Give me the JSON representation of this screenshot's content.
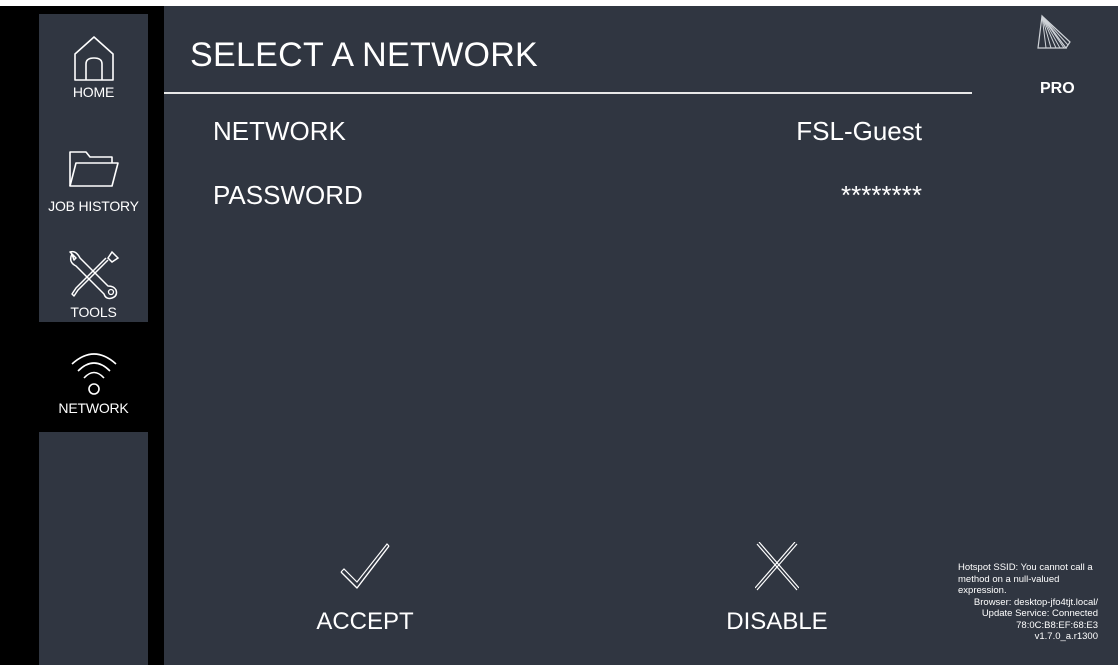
{
  "sidebar": {
    "items": [
      {
        "label": "HOME",
        "icon": "home-icon"
      },
      {
        "label": "JOB HISTORY",
        "icon": "folder-icon"
      },
      {
        "label": "TOOLS",
        "icon": "tools-icon"
      },
      {
        "label": "NETWORK",
        "icon": "wifi-icon"
      }
    ]
  },
  "header": {
    "title": "SELECT A NETWORK",
    "edition": "PRO"
  },
  "form": {
    "network_label": "NETWORK",
    "network_value": "FSL-Guest",
    "password_label": "PASSWORD",
    "password_value": "********"
  },
  "actions": {
    "accept_label": "ACCEPT",
    "disable_label": "DISABLE"
  },
  "status": {
    "hotspot": "Hotspot SSID: You cannot call a method on a null-valued expression.",
    "browser": "Browser: desktop-jfo4tjt.local/",
    "update": "Update Service: Connected",
    "mac": "78:0C:B8:EF:68:E3",
    "version": "v1.7.0_a.r1300"
  }
}
